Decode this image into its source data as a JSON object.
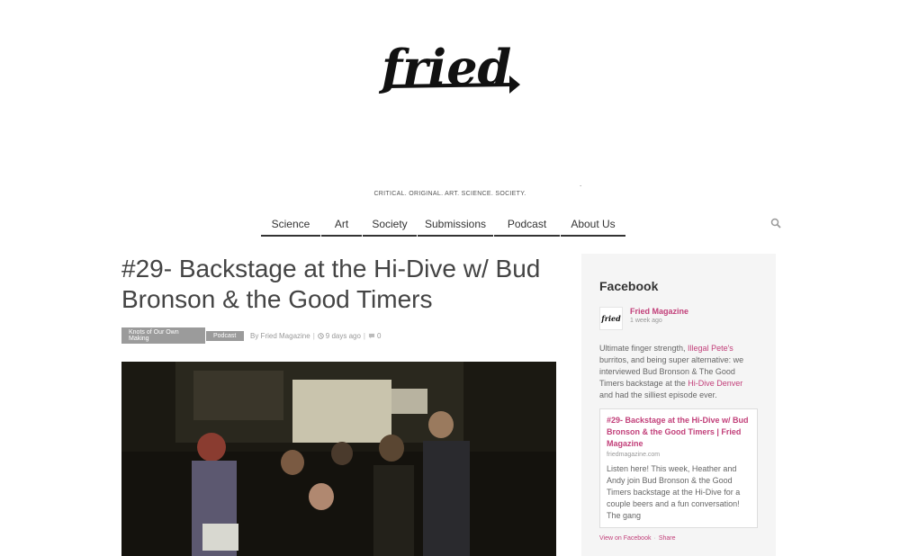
{
  "brand": {
    "logo_text": "fried",
    "tagline": "CRITICAL. ORIGINAL. ART. SCIENCE. SOCIETY.",
    "dot": "."
  },
  "nav": {
    "items": [
      {
        "label": "Science"
      },
      {
        "label": "Art"
      },
      {
        "label": "Society"
      },
      {
        "label": "Submissions"
      },
      {
        "label": "Podcast"
      },
      {
        "label": "About Us"
      }
    ],
    "search_icon": "search-icon"
  },
  "post": {
    "title": "#29- Backstage at the Hi-Dive w/ Bud Bronson & the Good Timers",
    "categories": [
      "Knots of Our Own Making",
      "Podcast"
    ],
    "author": "By Fried Magazine",
    "date": "9 days ago",
    "comments": "0",
    "date_icon": "clock-icon",
    "comments_icon": "comment-icon"
  },
  "sidebar": {
    "title": "Facebook",
    "page_name": "Fried Magazine",
    "avatar_text": "fried",
    "time": "1 week ago",
    "text_1": "Ultimate finger strength, ",
    "link_1": "Illegal Pete's",
    "text_2": " burritos, and being super alternative: we interviewed Bud Bronson & The Good Timers backstage at the ",
    "link_2": "Hi-Dive Denver",
    "text_3": " and had the silliest episode ever.",
    "card": {
      "title": "#29- Backstage at the Hi-Dive w/ Bud Bronson & the Good Timers | Fried Magazine",
      "domain": "friedmagazine.com",
      "description": "Listen here! This week, Heather and Andy join Bud Bronson & the Good Timers backstage at the Hi-Dive for a couple beers and a fun conversation! The gang"
    },
    "view_label": "View on Facebook",
    "footer_sep": "·",
    "share_label": "Share"
  },
  "colors": {
    "accent": "#c2407a",
    "category_bg": "#9b9b9b",
    "sidebar_bg": "#f5f5f5"
  }
}
